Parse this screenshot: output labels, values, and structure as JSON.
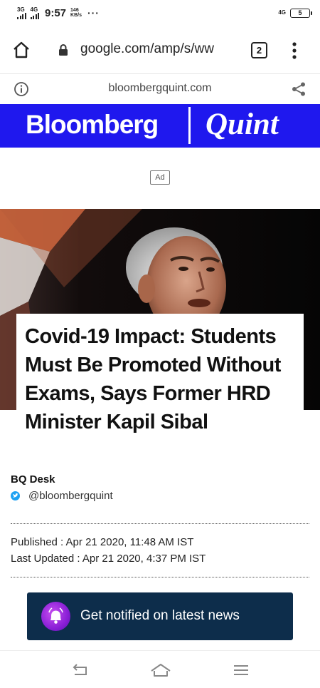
{
  "status_bar": {
    "net1": "3G",
    "net2": "4G",
    "time": "9:57",
    "speed_value": "146",
    "speed_unit": "KB/s",
    "more": "···",
    "net_right": "4G",
    "battery": "5"
  },
  "browser": {
    "url": "google.com/amp/s/ww",
    "tab_count": "2"
  },
  "amp_bar": {
    "domain": "bloombergquint.com"
  },
  "brand": {
    "left": "Bloomberg",
    "right": "Quint"
  },
  "ad": {
    "label": "Ad"
  },
  "article": {
    "headline": "Covid-19 Impact: Students Must Be Promoted Without Exams, Says Former HRD Minister Kapil Sibal",
    "author": "BQ Desk",
    "handle": "@bloombergquint",
    "published": "Published : Apr 21 2020, 11:48 AM IST",
    "updated": "Last Updated : Apr 21 2020, 4:37 PM IST"
  },
  "notify": {
    "label": "Get notified on latest news"
  },
  "colors": {
    "brand_blue": "#1f18ee",
    "notify_bg": "#0d2d4b",
    "twitter_blue": "#1da1f2",
    "bell_purple": "#8a1fd6"
  },
  "icons": {
    "home": "home-icon",
    "lock": "lock-icon",
    "menu": "more-vert-icon",
    "info": "info-icon",
    "share": "share-icon",
    "twitter": "twitter-icon",
    "bell": "bell-icon",
    "back": "back-icon",
    "nav_home": "home-outline-icon",
    "recents": "menu-lines-icon"
  }
}
